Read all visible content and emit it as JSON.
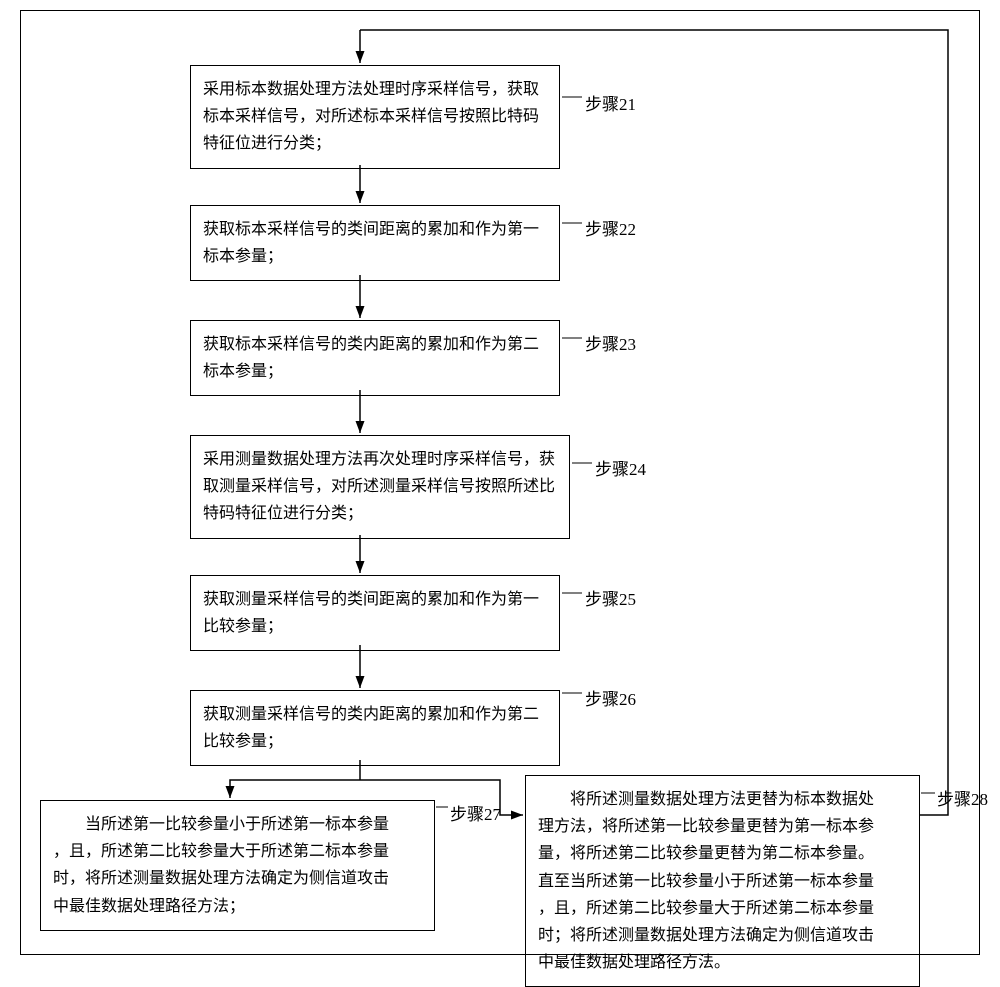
{
  "outer": {},
  "steps": {
    "s21": {
      "label": "步骤21",
      "text": "采用标本数据处理方法处理时序采样信号，获取标本采样信号，对所述标本采样信号按照比特码特征位进行分类；"
    },
    "s22": {
      "label": "步骤22",
      "text": "获取标本采样信号的类间距离的累加和作为第一标本参量；"
    },
    "s23": {
      "label": "步骤23",
      "text": "获取标本采样信号的类内距离的累加和作为第二标本参量；"
    },
    "s24": {
      "label": "步骤24",
      "text": "采用测量数据处理方法再次处理时序采样信号，获取测量采样信号，对所述测量采样信号按照所述比特码特征位进行分类；"
    },
    "s25": {
      "label": "步骤25",
      "text": "获取测量采样信号的类间距离的累加和作为第一比较参量；"
    },
    "s26": {
      "label": "步骤26",
      "text": "获取测量采样信号的类内距离的累加和作为第二比较参量；"
    },
    "s27": {
      "label": "步骤27",
      "line1": "当所述第一比较参量小于所述第一标本参量",
      "line2": "，且，所述第二比较参量大于所述第二标本参量",
      "line3": "时，将所述测量数据处理方法确定为侧信道攻击",
      "line4": "中最佳数据处理路径方法；"
    },
    "s28": {
      "label": "步骤28",
      "line1": "将所述测量数据处理方法更替为标本数据处",
      "line2": "理方法，将所述第一比较参量更替为第一标本参",
      "line3": "量，将所述第二比较参量更替为第二标本参量。",
      "line4": "直至当所述第一比较参量小于所述第一标本参量",
      "line5": "，且，所述第二比较参量大于所述第二标本参量",
      "line6": "时；将所述测量数据处理方法确定为侧信道攻击",
      "line7": "中最佳数据处理路径方法。"
    }
  }
}
